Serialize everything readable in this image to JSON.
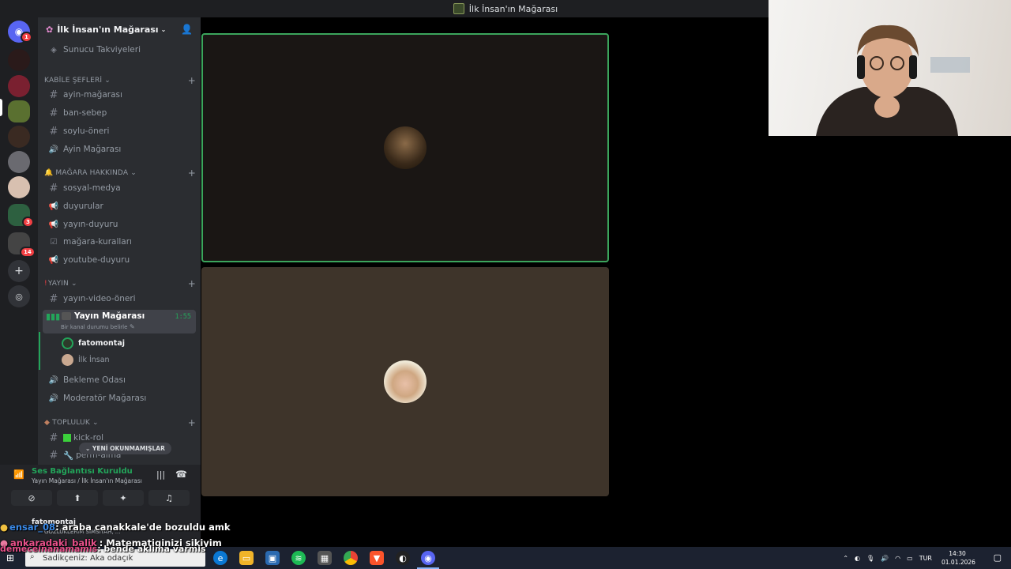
{
  "window": {
    "title": "İlk İnsan'ın Mağarası"
  },
  "server": {
    "name": "İlk İnsan'ın Mağarası",
    "boosts": "Sunucu Takviyeleri"
  },
  "rail_badges": [
    "1",
    "3",
    "14"
  ],
  "categories": [
    {
      "label": "KABİLE ŞEFLERİ"
    },
    {
      "label": "MAĞARA HAKKINDA"
    },
    {
      "label": "YAYIN"
    },
    {
      "label": "TOPLULUK"
    }
  ],
  "channels": {
    "ayin_magarasi": "ayin-mağarası",
    "ban_sebep": "ban-sebep",
    "soylu_oneri": "soylu-öneri",
    "ayin_voice": "Ayin Mağarası",
    "sosyal_medya": "sosyal-medya",
    "duyurular": "duyurular",
    "yayin_duyuru": "yayın-duyuru",
    "magara_kurallari": "mağara-kuralları",
    "youtube_duyuru": "youtube-duyuru",
    "yayin_video_oneri": "yayın-video-öneri",
    "yayin_magarasi": "Yayın Mağarası",
    "yayin_status": "Bir kanal durumu belirle",
    "yayin_timer": "1:55",
    "bekleme": "Bekleme Odası",
    "moderator": "Moderatör Mağarası",
    "kick_rol": "kick-rol",
    "perm_alma": "perm-alma"
  },
  "voice_users": [
    {
      "name": "fatomontaj"
    },
    {
      "name": "İlk İnsan"
    }
  ],
  "unread_pill": "YENİ OKUNMAMIŞLAR",
  "voice_panel": {
    "status": "Ses Bağlantısı Kuruldu",
    "location": "Yayın Mağarası / İlk İnsan'ın Mağarası"
  },
  "userbar": {
    "name": "fatomontaj",
    "status": "GÖZLÜKLERİM SİMSİYAH, ..."
  },
  "chat_overlay": [
    {
      "user": "ensar_08",
      "message": ": araba canakkale'de bozuldu amk"
    },
    {
      "user": "ankaradaki_balik",
      "message": ": Matematiginizi sikiyim"
    },
    {
      "user": "demeceinanamamis",
      "message": ": bende aklima varmis"
    }
  ],
  "taskbar": {
    "search_placeholder": "Sadikçeniz: Aka odaçık",
    "lang": "TUR",
    "time": "14:30",
    "date": "01.01.2026"
  },
  "colors": {
    "accent_green": "#23a55a",
    "speaking_border": "#3ba55c",
    "badge_red": "#f23f43"
  }
}
